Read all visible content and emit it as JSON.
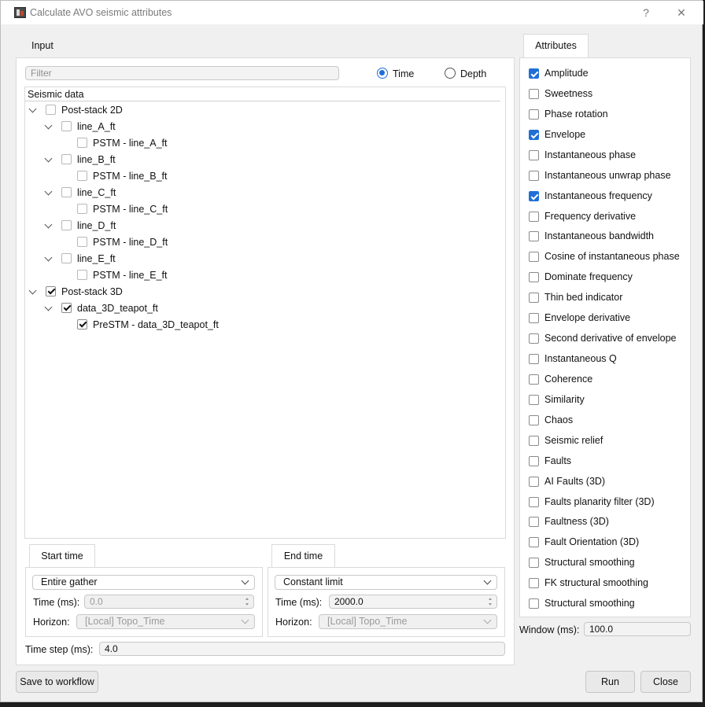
{
  "window": {
    "title": "Calculate AVO seismic attributes",
    "help": "?",
    "close": "✕"
  },
  "input": {
    "tab_label": "Input",
    "filter_placeholder": "Filter",
    "domain_time": "Time",
    "domain_depth": "Depth",
    "selected_domain": "Time",
    "tree_header": "Seismic data",
    "tree": {
      "post2d": {
        "label": "Post-stack 2D",
        "lines": [
          {
            "label": "line_A_ft",
            "child": "PSTM - line_A_ft"
          },
          {
            "label": "line_B_ft",
            "child": "PSTM - line_B_ft"
          },
          {
            "label": "line_C_ft",
            "child": "PSTM - line_C_ft"
          },
          {
            "label": "line_D_ft",
            "child": "PSTM - line_D_ft"
          },
          {
            "label": "line_E_ft",
            "child": "PSTM - line_E_ft"
          }
        ]
      },
      "post3d": {
        "label": "Post-stack 3D",
        "checked": true,
        "volume": "data_3D_teapot_ft",
        "child": "PreSTM - data_3D_teapot_ft"
      }
    }
  },
  "start_time": {
    "tab_label": "Start time",
    "mode": "Entire gather",
    "time_label": "Time (ms):",
    "time_value": "0.0",
    "horizon_label": "Horizon:",
    "horizon_value": "[Local] Topo_Time"
  },
  "end_time": {
    "tab_label": "End time",
    "mode": "Constant limit",
    "time_label": "Time (ms):",
    "time_value": "2000.0",
    "horizon_label": "Horizon:",
    "horizon_value": "[Local] Topo_Time"
  },
  "time_step": {
    "label": "Time step (ms):",
    "value": "4.0"
  },
  "attributes": {
    "tab_label": "Attributes",
    "items": [
      {
        "label": "Amplitude",
        "checked": true
      },
      {
        "label": "Sweetness",
        "checked": false
      },
      {
        "label": "Phase rotation",
        "checked": false
      },
      {
        "label": "Envelope",
        "checked": true
      },
      {
        "label": "Instantaneous phase",
        "checked": false
      },
      {
        "label": "Instantaneous unwrap phase",
        "checked": false
      },
      {
        "label": "Instantaneous frequency",
        "checked": true
      },
      {
        "label": "Frequency derivative",
        "checked": false
      },
      {
        "label": "Instantaneous bandwidth",
        "checked": false
      },
      {
        "label": "Cosine of instantaneous phase",
        "checked": false
      },
      {
        "label": "Dominate frequency",
        "checked": false
      },
      {
        "label": "Thin bed indicator",
        "checked": false
      },
      {
        "label": "Envelope derivative",
        "checked": false
      },
      {
        "label": "Second derivative of envelope",
        "checked": false
      },
      {
        "label": "Instantaneous Q",
        "checked": false
      },
      {
        "label": "Coherence",
        "checked": false
      },
      {
        "label": "Similarity",
        "checked": false
      },
      {
        "label": "Chaos",
        "checked": false
      },
      {
        "label": "Seismic relief",
        "checked": false
      },
      {
        "label": "Faults",
        "checked": false
      },
      {
        "label": "AI Faults (3D)",
        "checked": false
      },
      {
        "label": "Faults planarity filter (3D)",
        "checked": false
      },
      {
        "label": "Faultness (3D)",
        "checked": false
      },
      {
        "label": "Fault Orientation (3D)",
        "checked": false
      },
      {
        "label": "Structural smoothing",
        "checked": false
      },
      {
        "label": "FK structural smoothing",
        "checked": false
      },
      {
        "label": "Structural smoothing",
        "checked": false
      }
    ],
    "window_label": "Window (ms):",
    "window_value": "100.0"
  },
  "footer": {
    "save_label": "Save to workflow",
    "run_label": "Run",
    "close_label": "Close"
  },
  "colors": {
    "accent": "#1f6fd6",
    "background": "#f0f0f0"
  }
}
